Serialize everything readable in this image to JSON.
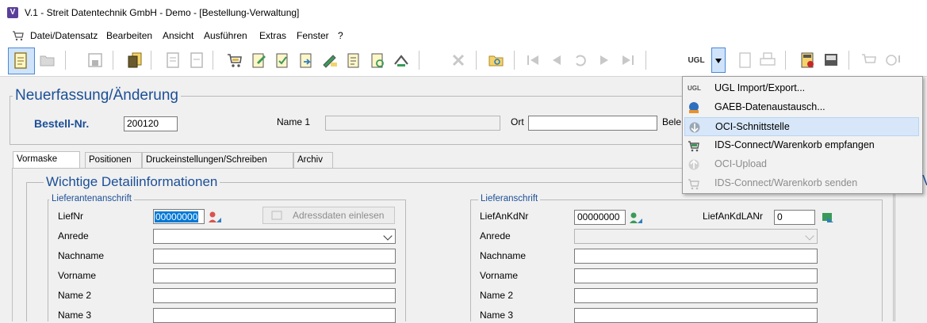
{
  "window": {
    "title": "V.1 - Streit Datentechnik GmbH - Demo - [Bestellung-Verwaltung]",
    "app_icon": "V"
  },
  "menubar": [
    "Datei/Datensatz",
    "Bearbeiten",
    "Ansicht",
    "Ausführen",
    "Extras",
    "Fenster",
    "?"
  ],
  "toolbar": {
    "ugl_icon_text": "UGL"
  },
  "header_group": {
    "title": "Neuerfassung/Änderung",
    "bestell_label": "Bestell-Nr.",
    "bestell_value": "200120",
    "name1_label": "Name 1",
    "name1_value": "",
    "ort_label": "Ort",
    "ort_value": "",
    "bele_label": "Bele"
  },
  "tabs": [
    "Vormaske",
    "Positionen",
    "Druckeinstellungen/Schreiben",
    "Archiv"
  ],
  "details": {
    "title": "Wichtige Detailinformationen",
    "left": {
      "title": "Lieferantenanschrift",
      "liefnr_label": "LiefNr",
      "liefnr_value": "00000000",
      "adress_button": "Adressdaten einlesen",
      "anrede_label": "Anrede",
      "nachname_label": "Nachname",
      "vorname_label": "Vorname",
      "name2_label": "Name 2",
      "name3_label": "Name 3"
    },
    "right": {
      "title": "Lieferanschrift",
      "liefankdnr_label": "LiefAnKdNr",
      "liefankdnr_value": "00000000",
      "liefankdlanr_label": "LiefAnKdLANr",
      "liefankdlanr_value": "0",
      "anrede_label": "Anrede",
      "nachname_label": "Nachname",
      "vorname_label": "Vorname",
      "name2_label": "Name 2",
      "name3_label": "Name 3"
    }
  },
  "dropdown": {
    "items": [
      {
        "label": "UGL Import/Export...",
        "icon": "ugl-icon",
        "enabled": true
      },
      {
        "label": "GAEB-Datenaustausch...",
        "icon": "gaeb-icon",
        "enabled": true
      },
      {
        "label": "OCI-Schnittstelle",
        "icon": "oci-icon",
        "enabled": true,
        "highlighted": true
      },
      {
        "label": "IDS-Connect/Warenkorb empfangen",
        "icon": "cart-icon",
        "enabled": true
      },
      {
        "label": "OCI-Upload",
        "icon": "oci-upload-icon",
        "enabled": false
      },
      {
        "label": "IDS-Connect/Warenkorb senden",
        "icon": "cart-send-icon",
        "enabled": false
      }
    ]
  },
  "colors": {
    "section_title": "#1b4f97",
    "highlight": "#d7e7f9",
    "selection": "#0078d7"
  }
}
